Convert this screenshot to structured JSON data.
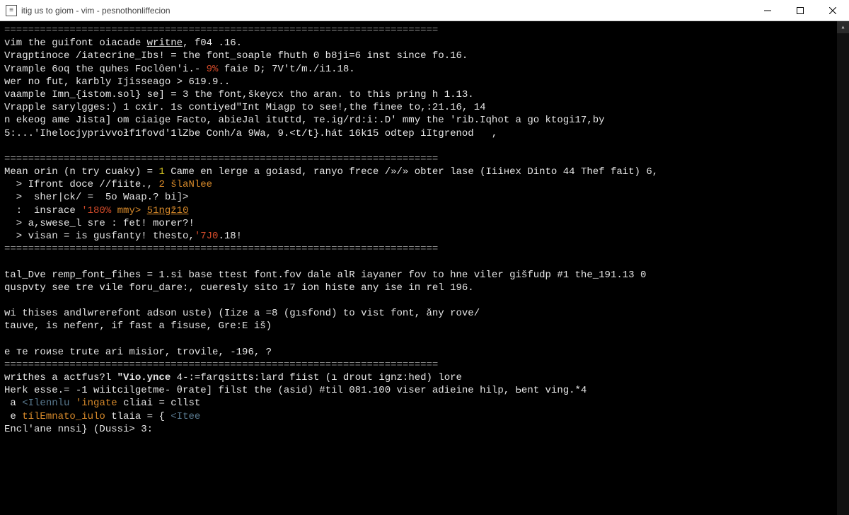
{
  "window": {
    "title": "itig us to giom - vim - pesnothonliffecion"
  },
  "lines": [
    {
      "segs": [
        {
          "t": "=========================================================================",
          "c": "c-dim"
        }
      ]
    },
    {
      "segs": [
        {
          "t": "vim the guifont oiacade ",
          "c": "c-white"
        },
        {
          "t": "writne",
          "c": "c-white underline"
        },
        {
          "t": ", f04 .16.",
          "c": "c-white"
        }
      ]
    },
    {
      "segs": [
        {
          "t": "Vragptinoce /iatecrine_Ibs! = the font_soaple fhuth 0 b8ji=6 inst since fo.16.",
          "c": "c-white"
        }
      ]
    },
    {
      "segs": [
        {
          "t": "Vrample 6oq the quhes Foclôen'i.- ",
          "c": "c-white"
        },
        {
          "t": "9%",
          "c": "c-red"
        },
        {
          "t": " faie D; 7V't/m./i1.18.",
          "c": "c-white"
        }
      ]
    },
    {
      "segs": [
        {
          "t": "wer no fut, karbly Ijisseago > 619.9..",
          "c": "c-white"
        }
      ]
    },
    {
      "segs": [
        {
          "t": "vaample Imn_{istom.sol} se] = 3 the font,škeycx tho aran. to this pring h 1.13.",
          "c": "c-white"
        }
      ]
    },
    {
      "segs": [
        {
          "t": "Vrapple sarylgges:) 1 cxir. 1s contiyed\"Int Miagp to see!,the finee to,:21.16, 14",
          "c": "c-white"
        }
      ]
    },
    {
      "segs": [
        {
          "t": "n ekeog ame Jista] om ciaige Facto, abieJal ituttd, тe.ig/rd:i:.D' mmy the 'rib.Iqhot a go ktogi17,by",
          "c": "c-white"
        }
      ]
    },
    {
      "segs": [
        {
          "t": "5:...'Ihelocjyprivvołf1fovd'1lZbe Conh/a 9Wa, 9.<t/t}.hát 16k15 odtep iItgrenod   ,",
          "c": "c-white"
        }
      ]
    },
    {
      "segs": [
        {
          "t": " ",
          "c": "c-white"
        }
      ]
    },
    {
      "segs": [
        {
          "t": "=========================================================================",
          "c": "c-dim"
        }
      ]
    },
    {
      "segs": [
        {
          "t": "Mean orin (n try cuaky) = ",
          "c": "c-white"
        },
        {
          "t": "1",
          "c": "c-yellow"
        },
        {
          "t": " Came en lerge a goiasd, ranyo frece /»/» obter lase (Iiінex Dinto 44 Thef fait) 6,",
          "c": "c-white"
        }
      ]
    },
    {
      "segs": [
        {
          "t": "  > Ifront doce //fiite., ",
          "c": "c-white"
        },
        {
          "t": "2 šlaNlee",
          "c": "c-orange"
        }
      ]
    },
    {
      "segs": [
        {
          "t": "  >  sher|ck/ =  5o Waap.? bi]>",
          "c": "c-white"
        }
      ]
    },
    {
      "segs": [
        {
          "t": "  :  insrace ",
          "c": "c-white"
        },
        {
          "t": "'180%",
          "c": "c-red"
        },
        {
          "t": " mmy> ",
          "c": "c-orange"
        },
        {
          "t": "51ngž10",
          "c": "c-orange underline"
        }
      ]
    },
    {
      "segs": [
        {
          "t": "  > a,swese_l sre : fet! morer?!",
          "c": "c-white"
        }
      ]
    },
    {
      "segs": [
        {
          "t": "  > visan = is gusfanty! thesto,",
          "c": "c-white"
        },
        {
          "t": "'7J0",
          "c": "c-red"
        },
        {
          "t": ".18!",
          "c": "c-white"
        }
      ]
    },
    {
      "segs": [
        {
          "t": "=========================================================================",
          "c": "c-dim"
        }
      ]
    },
    {
      "segs": [
        {
          "t": " ",
          "c": "c-white"
        }
      ]
    },
    {
      "segs": [
        {
          "t": "tal_Dve remp_font_fihes = 1.si base ttest font.fov dale alR iayaner fov to hne viler gišfudp #1 the_191.13 0",
          "c": "c-white"
        }
      ]
    },
    {
      "segs": [
        {
          "t": "quspvty see tre vile foru_dare:, cueresly sito 17 ion histe any ise iп rel 196.",
          "c": "c-white"
        }
      ]
    },
    {
      "segs": [
        {
          "t": " ",
          "c": "c-white"
        }
      ]
    },
    {
      "segs": [
        {
          "t": "wi thises andlwrerefont adson uste) (Iize a =8 (gısfond) to vist font, ăny rove/",
          "c": "c-white"
        }
      ]
    },
    {
      "segs": [
        {
          "t": "tauve, is nefenr, if fast a fisuse, Gre:E iš)",
          "c": "c-white"
        }
      ]
    },
    {
      "segs": [
        {
          "t": " ",
          "c": "c-white"
        }
      ]
    },
    {
      "segs": [
        {
          "t": "e те roиse trute ari misior, trovile, -196, ?",
          "c": "c-white"
        }
      ]
    },
    {
      "segs": [
        {
          "t": "=========================================================================",
          "c": "c-dim"
        }
      ]
    },
    {
      "segs": [
        {
          "t": "writhes a actfus?l ",
          "c": "c-white"
        },
        {
          "t": "\"Vio.ynce",
          "c": "c-white bold"
        },
        {
          "t": " 4-:=farqsitts:lard fiist (ı drout ignz:hed) lore",
          "c": "c-white"
        }
      ]
    },
    {
      "segs": [
        {
          "t": "Herk esse.= -1 wiitсilgetme- θrate] filst the (asid) #til 081.100 viser adiеine hilp, Ьent ving.*4",
          "c": "c-white"
        }
      ]
    },
    {
      "segs": [
        {
          "t": " a ",
          "c": "c-white"
        },
        {
          "t": "<Ilennlu",
          "c": "c-comment"
        },
        {
          "t": " 'ingate ",
          "c": "c-orange"
        },
        {
          "t": "cliai = cllst",
          "c": "c-white"
        }
      ]
    },
    {
      "segs": [
        {
          "t": " e ",
          "c": "c-white"
        },
        {
          "t": "tílEmnatо_iulo",
          "c": "c-orange"
        },
        {
          "t": " tlaia = { ",
          "c": "c-white"
        },
        {
          "t": "<Itee",
          "c": "c-comment"
        }
      ]
    },
    {
      "segs": [
        {
          "t": "Encl'ane nnsi} (Dussi> 3:",
          "c": "c-white"
        }
      ]
    }
  ]
}
